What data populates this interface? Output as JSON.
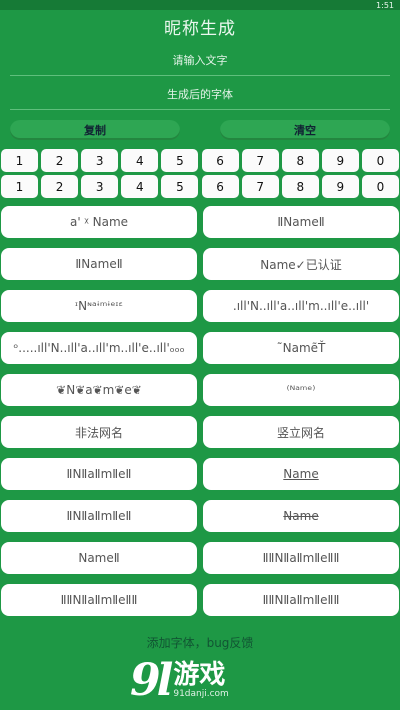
{
  "status_bar": {
    "time": "1:51"
  },
  "header": {
    "title": "昵称生成"
  },
  "input": {
    "placeholder": "请输入文字"
  },
  "output": {
    "label": "生成后的字体"
  },
  "actions": {
    "copy_label": "复制",
    "clear_label": "清空"
  },
  "digit_rows": [
    [
      "1",
      "2",
      "3",
      "4",
      "5",
      "6",
      "7",
      "8",
      "9",
      "0"
    ],
    [
      "1",
      "2",
      "3",
      "4",
      "5",
      "6",
      "7",
      "8",
      "9",
      "0"
    ]
  ],
  "styles": [
    "a' ᵡ Name",
    "ⅡNameⅡ",
    "ⅡNameⅡ",
    "Name✓已认证",
    "ᶦNᶰᵃᶤᵐᶤᵉᶦᵋ",
    ".ıll'N..ıll'a..ıll'm..ıll'e..ıll'",
    "ᵒ.....ıll'N..ıll'a..ıll'm..ıll'e..ıll'ₒₒₒ",
    "˜NamẽŤ",
    "❦N❦a❦m❦e❦",
    "⁽ᴺᵃᵐᵉ⁾",
    "非法网名",
    "竖立网名",
    "ⅡNⅡaⅡmⅡeⅡ",
    "Name",
    "ⅡNⅡaⅡmⅡeⅡ",
    "Name",
    "NameⅡ",
    "ⅡⅡNⅡaⅡmⅡeⅡⅡ",
    "ⅡⅡNⅡaⅡmⅡeⅡⅡ",
    "ⅡⅡNⅡaⅡmⅡeⅡⅡ"
  ],
  "footer": {
    "text": "添加字体，bug反馈"
  },
  "watermark": {
    "mark": "9l",
    "name": "游戏",
    "site": "91danji.com"
  }
}
